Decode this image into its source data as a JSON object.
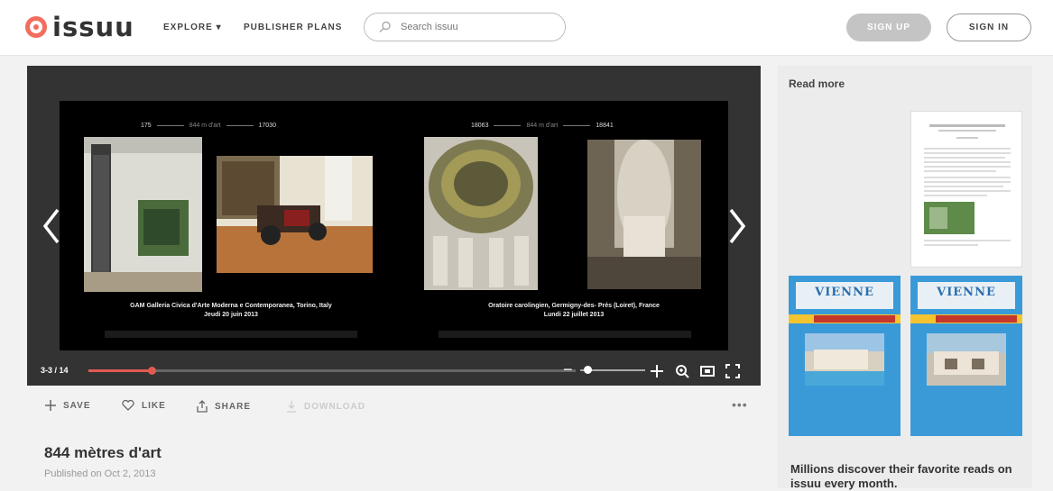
{
  "header": {
    "logo_text": "issuu",
    "nav_explore": "EXPLORE ▾",
    "nav_publisher_plans": "PUBLISHER PLANS",
    "search_placeholder": "Search issuu",
    "signup_label": "SIGN UP",
    "signin_label": "SIGN IN"
  },
  "viewer": {
    "left_page": {
      "head_start": "175",
      "head_mid": "844 m d'art",
      "head_end": "17030",
      "caption_line1": "GAM Galleria Civica d'Arte Moderna e Contemporanea, Torino, Italy",
      "caption_line2": "Jeudi 20 juin 2013"
    },
    "right_page": {
      "head_start": "18063",
      "head_mid": "844 m d'art",
      "head_end": "18841",
      "caption_line1": "Oratoire carolingien, Germigny-des- Prés (Loiret), France",
      "caption_line2": "Lundi 22 juillet 2013"
    },
    "page_count": "3-3 / 14",
    "progress_fraction": 0.13,
    "zoom_fraction": 0.05
  },
  "actions": {
    "save": "SAVE",
    "like": "LIKE",
    "share": "SHARE",
    "download": "DOWNLOAD",
    "more": "•••"
  },
  "document": {
    "title": "844 mètres d'art",
    "published": "Published on Oct 2, 2013"
  },
  "sidebar": {
    "heading": "Read more",
    "magazine_title": "VIENNE",
    "cta": "Millions discover their favorite reads on issuu every month."
  },
  "colors": {
    "brand": "#f36d5f",
    "progress": "#e15a52",
    "viewer_bg": "#333333",
    "magazine_blue": "#3a9ad8"
  }
}
